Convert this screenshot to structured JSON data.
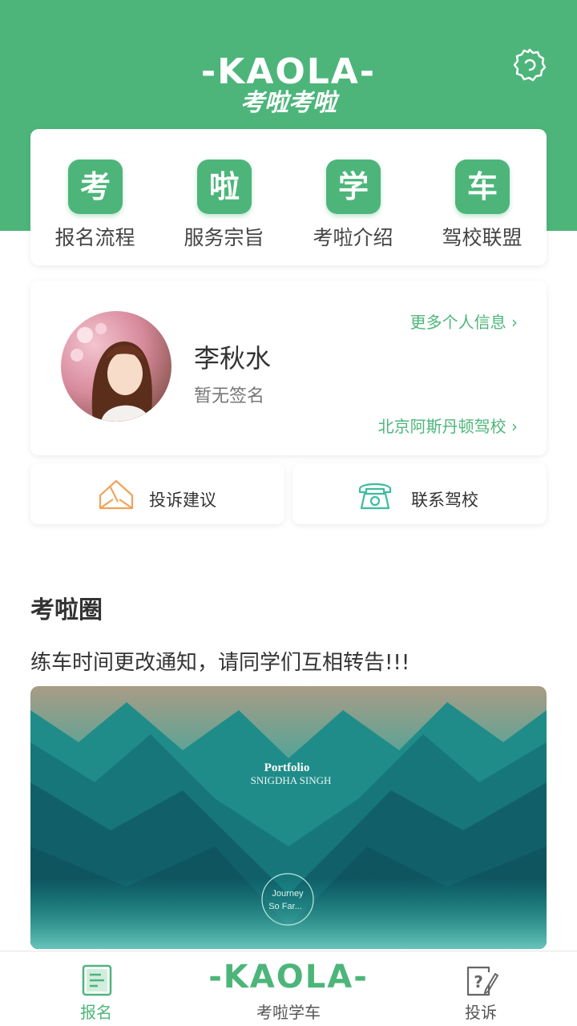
{
  "header": {
    "logo_en": "-KAOLA-",
    "logo_cn": "考啦考啦",
    "settings_icon": "settings-icon",
    "accent_color": "#4db57a"
  },
  "nav": {
    "items": [
      {
        "icon_char": "考",
        "label": "报名流程"
      },
      {
        "icon_char": "啦",
        "label": "服务宗旨"
      },
      {
        "icon_char": "学",
        "label": "考啦介绍"
      },
      {
        "icon_char": "车",
        "label": "驾校联盟"
      }
    ]
  },
  "profile": {
    "name": "李秋水",
    "signature": "暂无签名",
    "more_info": "更多个人信息 ›",
    "school": "北京阿斯丹顿驾校 ›"
  },
  "actions": {
    "complaint": "投诉建议",
    "contact": "联系驾校"
  },
  "feed": {
    "title": "考啦圈",
    "post_text": "练车时间更改通知，请同学们互相转告!!!",
    "image_title": "Portfolio",
    "image_subtitle": "SNIGDHA SINGH",
    "image_badge_line1": "Journey",
    "image_badge_line2": "So Far..."
  },
  "tabbar": {
    "register": "报名",
    "center_logo": "-KAOLA-",
    "center_label": "考啦学车",
    "complain": "投诉",
    "active_color": "#4db57a",
    "inactive_color": "#555555"
  }
}
